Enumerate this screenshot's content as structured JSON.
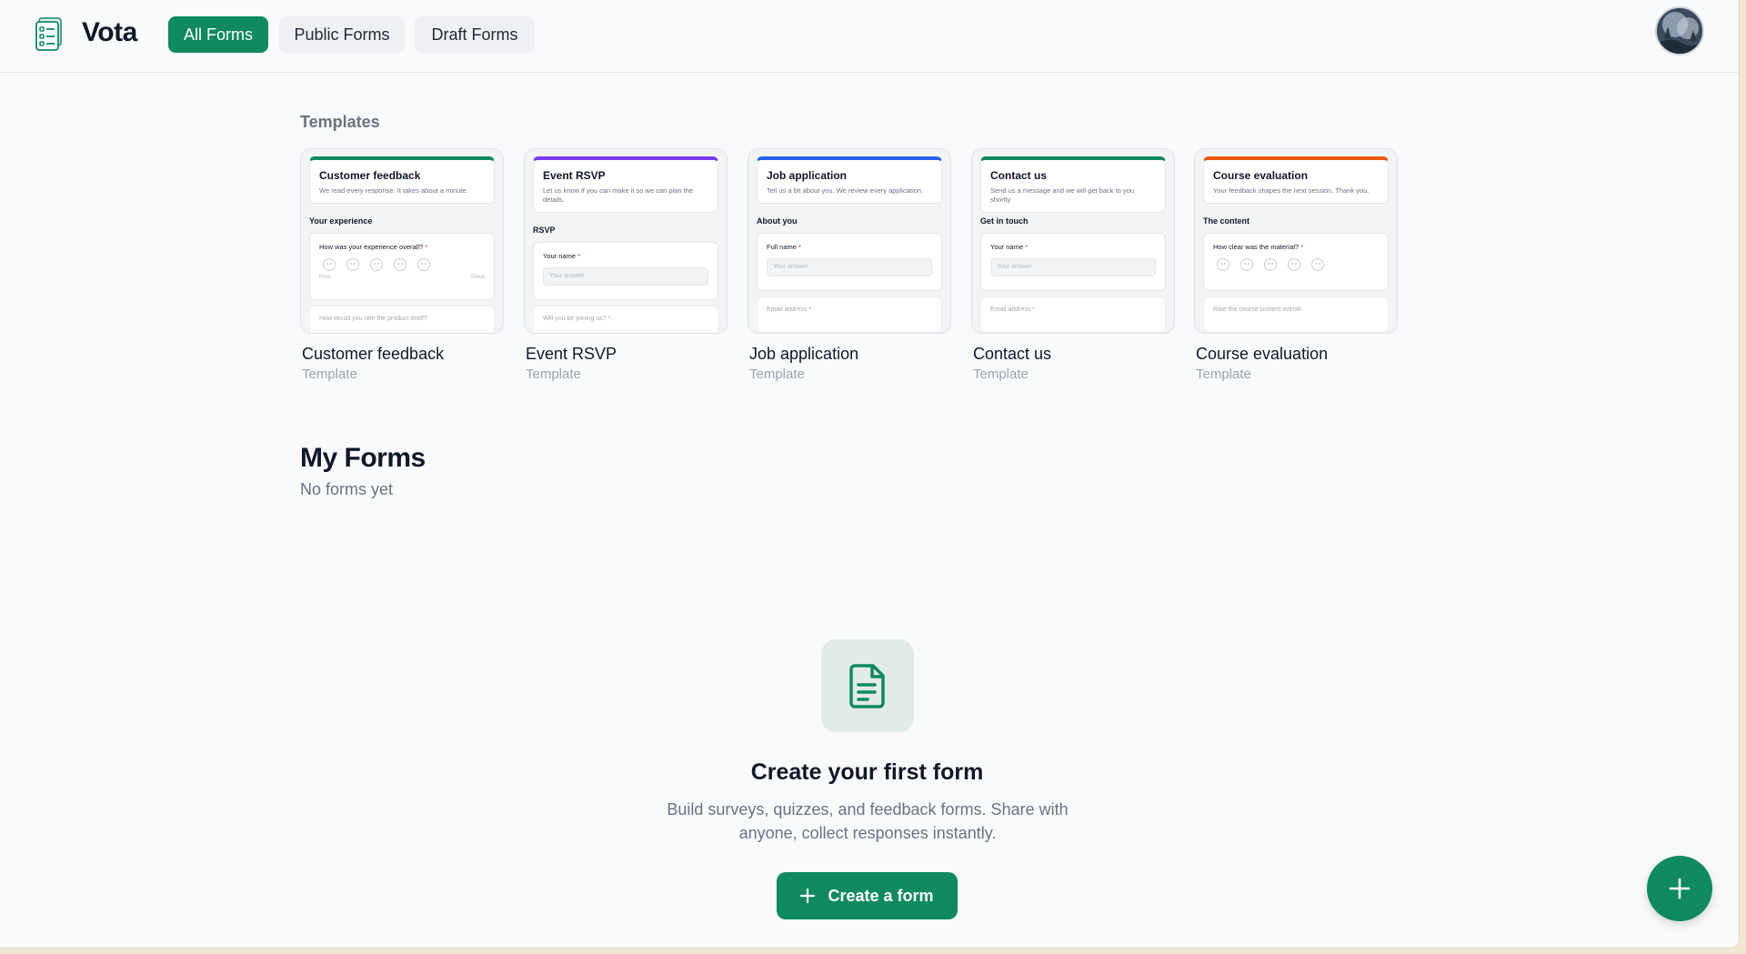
{
  "header": {
    "brand": "Vota",
    "tabs": [
      {
        "label": "All Forms",
        "active": true
      },
      {
        "label": "Public Forms",
        "active": false
      },
      {
        "label": "Draft Forms",
        "active": false
      }
    ],
    "icons": {
      "logo": "forms-list-icon",
      "avatar": "user-avatar"
    }
  },
  "templates": {
    "label": "Templates",
    "items": [
      {
        "name": "Customer feedback",
        "sub": "Template",
        "accent": "#0f8a5f",
        "head_title": "Customer feedback",
        "head_desc": "We read every response. It takes about a minute.",
        "section": "Your experience",
        "question": "How was your experience overall?",
        "required": "*",
        "scale_low": "Poor",
        "scale_high": "Great",
        "next": "How would you rate the product itself?"
      },
      {
        "name": "Event RSVP",
        "sub": "Template",
        "accent": "#7c3aed",
        "head_title": "Event RSVP",
        "head_desc": "Let us know if you can make it so we can plan the details.",
        "section": "RSVP",
        "question": "Your name",
        "required": "*",
        "input_placeholder": "Your answer",
        "next": "Will you be joining us? *"
      },
      {
        "name": "Job application",
        "sub": "Template",
        "accent": "#2563eb",
        "head_title": "Job application",
        "head_desc": "Tell us a bit about you. We review every application.",
        "section": "About you",
        "question": "Full name",
        "required": "*",
        "input_placeholder": "Your answer",
        "next": "Email address *"
      },
      {
        "name": "Contact us",
        "sub": "Template",
        "accent": "#0f8a5f",
        "head_title": "Contact us",
        "head_desc": "Send us a message and we will get back to you shortly.",
        "section": "Get in touch",
        "question": "Your name",
        "required": "*",
        "input_placeholder": "Your answer",
        "next": "Email address *"
      },
      {
        "name": "Course evaluation",
        "sub": "Template",
        "accent": "#ea580c",
        "head_title": "Course evaluation",
        "head_desc": "Your feedback shapes the next session. Thank you.",
        "section": "The content",
        "question": "How clear was the material?",
        "required": "*",
        "next": "Rate the course content overall"
      }
    ]
  },
  "my_forms": {
    "title": "My Forms",
    "empty_label": "No forms yet"
  },
  "empty_state": {
    "icon": "document-icon",
    "title": "Create your first form",
    "description": "Build surveys, quizzes, and feedback forms. Share with anyone, collect responses instantly.",
    "button_label": "Create a form"
  },
  "fab": {
    "icon": "plus-icon"
  },
  "colors": {
    "accent": "#0f8a5f",
    "background": "#f8fafc"
  }
}
